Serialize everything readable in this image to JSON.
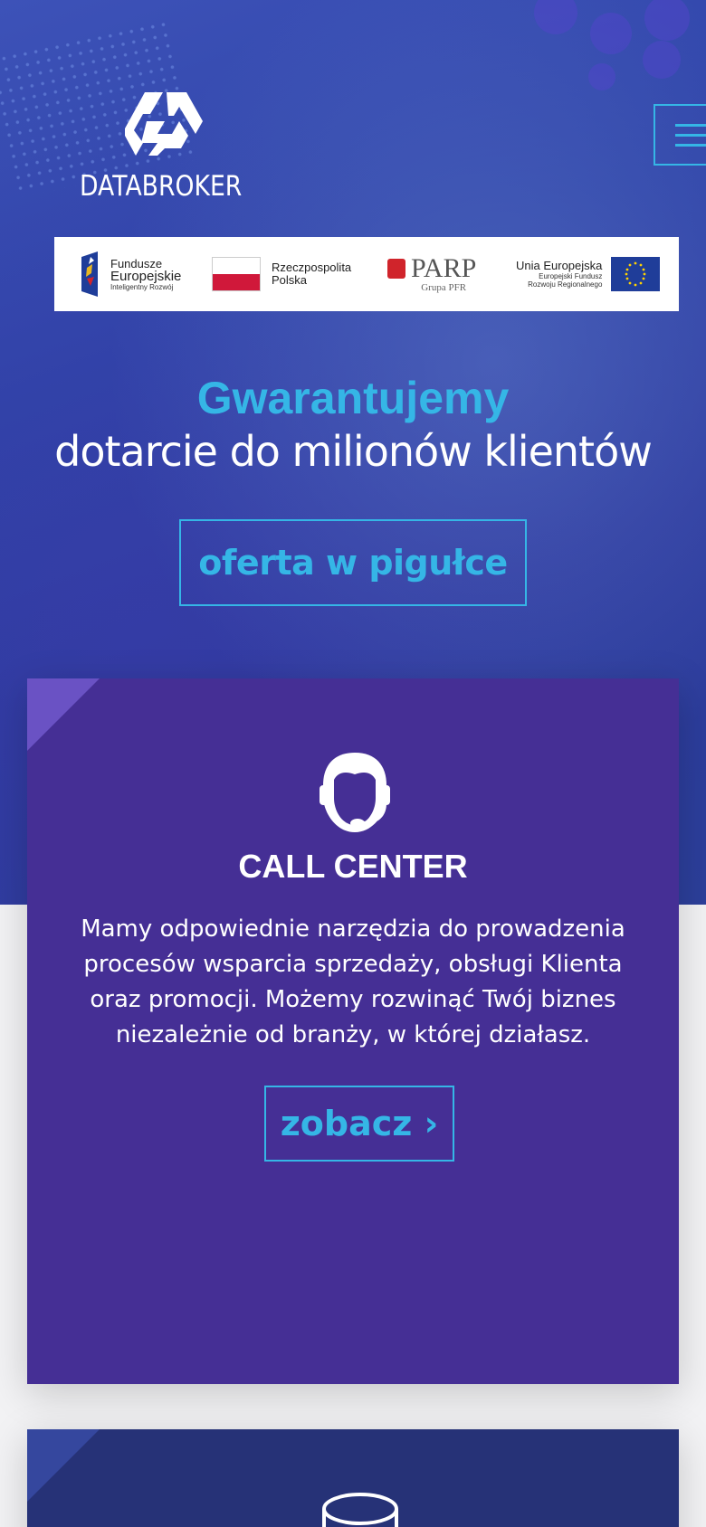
{
  "brand": {
    "name": "DATABROKER"
  },
  "menu": {
    "icon": "hamburger-menu-icon"
  },
  "eu_bar": {
    "funds": {
      "line1": "Fundusze",
      "line2": "Europejskie",
      "line3": "Inteligentny Rozwój"
    },
    "poland": {
      "line1": "Rzeczpospolita",
      "line2": "Polska"
    },
    "parp": {
      "name": "PARP",
      "sub": "Grupa PFR"
    },
    "eu": {
      "line1": "Unia Europejska",
      "line2": "Europejski Fundusz",
      "line3": "Rozwoju Regionalnego"
    }
  },
  "hero": {
    "title": "Gwarantujemy",
    "subtitle": "dotarcie do milionów klientów",
    "cta_label": "oferta w pigułce"
  },
  "callcenter": {
    "icon": "headset-agent-icon",
    "title": "CALL CENTER",
    "description": "Mamy odpowiednie narzędzia do prowadzenia procesów wsparcia sprzedaży, obsługi Klienta oraz promocji. Możemy rozwinąć Twój biznes niezależnie od branży, w której działasz.",
    "button_label": "zobacz ›"
  },
  "colors": {
    "accent": "#35b6e6",
    "card_purple": "#452f95",
    "card_navy": "#263277"
  }
}
